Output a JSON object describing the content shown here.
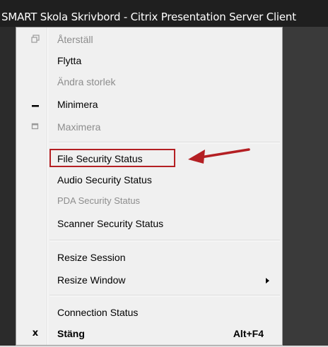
{
  "window": {
    "title": "SMART Skola Skrivbord - Citrix Presentation Server Client"
  },
  "menu": {
    "items": [
      {
        "label": "Återställ",
        "icon": "restore-icon",
        "disabled": true
      },
      {
        "label": "Flytta",
        "disabled": false
      },
      {
        "label": "Ändra storlek",
        "disabled": true
      },
      {
        "label": "Minimera",
        "icon": "minimize-icon",
        "disabled": false
      },
      {
        "label": "Maximera",
        "icon": "maximize-icon",
        "disabled": true
      },
      {
        "label": "File Security Status",
        "disabled": false,
        "highlighted": true
      },
      {
        "label": "Audio Security Status",
        "disabled": false
      },
      {
        "label": "PDA Security Status",
        "disabled": true
      },
      {
        "label": "Scanner Security Status",
        "disabled": false
      },
      {
        "label": "Resize Session",
        "disabled": false
      },
      {
        "label": "Resize Window",
        "disabled": false,
        "submenu": true
      },
      {
        "label": "Connection Status",
        "disabled": false
      },
      {
        "label": "Stäng",
        "icon": "close-icon",
        "shortcut": "Alt+F4",
        "bold": true
      }
    ]
  },
  "annotation": {
    "highlight_color": "#b41f23",
    "arrow_color": "#b41f23"
  }
}
